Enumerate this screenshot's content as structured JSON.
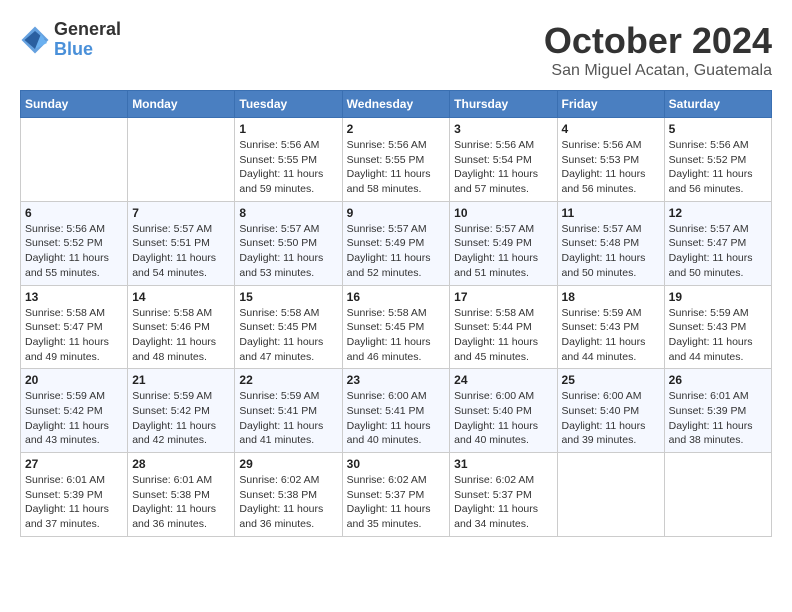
{
  "header": {
    "logo": {
      "general": "General",
      "blue": "Blue"
    },
    "title": "October 2024",
    "location": "San Miguel Acatan, Guatemala"
  },
  "weekdays": [
    "Sunday",
    "Monday",
    "Tuesday",
    "Wednesday",
    "Thursday",
    "Friday",
    "Saturday"
  ],
  "weeks": [
    [
      {
        "day": null
      },
      {
        "day": null
      },
      {
        "day": "1",
        "sunrise": "Sunrise: 5:56 AM",
        "sunset": "Sunset: 5:55 PM",
        "daylight": "Daylight: 11 hours and 59 minutes."
      },
      {
        "day": "2",
        "sunrise": "Sunrise: 5:56 AM",
        "sunset": "Sunset: 5:55 PM",
        "daylight": "Daylight: 11 hours and 58 minutes."
      },
      {
        "day": "3",
        "sunrise": "Sunrise: 5:56 AM",
        "sunset": "Sunset: 5:54 PM",
        "daylight": "Daylight: 11 hours and 57 minutes."
      },
      {
        "day": "4",
        "sunrise": "Sunrise: 5:56 AM",
        "sunset": "Sunset: 5:53 PM",
        "daylight": "Daylight: 11 hours and 56 minutes."
      },
      {
        "day": "5",
        "sunrise": "Sunrise: 5:56 AM",
        "sunset": "Sunset: 5:52 PM",
        "daylight": "Daylight: 11 hours and 56 minutes."
      }
    ],
    [
      {
        "day": "6",
        "sunrise": "Sunrise: 5:56 AM",
        "sunset": "Sunset: 5:52 PM",
        "daylight": "Daylight: 11 hours and 55 minutes."
      },
      {
        "day": "7",
        "sunrise": "Sunrise: 5:57 AM",
        "sunset": "Sunset: 5:51 PM",
        "daylight": "Daylight: 11 hours and 54 minutes."
      },
      {
        "day": "8",
        "sunrise": "Sunrise: 5:57 AM",
        "sunset": "Sunset: 5:50 PM",
        "daylight": "Daylight: 11 hours and 53 minutes."
      },
      {
        "day": "9",
        "sunrise": "Sunrise: 5:57 AM",
        "sunset": "Sunset: 5:49 PM",
        "daylight": "Daylight: 11 hours and 52 minutes."
      },
      {
        "day": "10",
        "sunrise": "Sunrise: 5:57 AM",
        "sunset": "Sunset: 5:49 PM",
        "daylight": "Daylight: 11 hours and 51 minutes."
      },
      {
        "day": "11",
        "sunrise": "Sunrise: 5:57 AM",
        "sunset": "Sunset: 5:48 PM",
        "daylight": "Daylight: 11 hours and 50 minutes."
      },
      {
        "day": "12",
        "sunrise": "Sunrise: 5:57 AM",
        "sunset": "Sunset: 5:47 PM",
        "daylight": "Daylight: 11 hours and 50 minutes."
      }
    ],
    [
      {
        "day": "13",
        "sunrise": "Sunrise: 5:58 AM",
        "sunset": "Sunset: 5:47 PM",
        "daylight": "Daylight: 11 hours and 49 minutes."
      },
      {
        "day": "14",
        "sunrise": "Sunrise: 5:58 AM",
        "sunset": "Sunset: 5:46 PM",
        "daylight": "Daylight: 11 hours and 48 minutes."
      },
      {
        "day": "15",
        "sunrise": "Sunrise: 5:58 AM",
        "sunset": "Sunset: 5:45 PM",
        "daylight": "Daylight: 11 hours and 47 minutes."
      },
      {
        "day": "16",
        "sunrise": "Sunrise: 5:58 AM",
        "sunset": "Sunset: 5:45 PM",
        "daylight": "Daylight: 11 hours and 46 minutes."
      },
      {
        "day": "17",
        "sunrise": "Sunrise: 5:58 AM",
        "sunset": "Sunset: 5:44 PM",
        "daylight": "Daylight: 11 hours and 45 minutes."
      },
      {
        "day": "18",
        "sunrise": "Sunrise: 5:59 AM",
        "sunset": "Sunset: 5:43 PM",
        "daylight": "Daylight: 11 hours and 44 minutes."
      },
      {
        "day": "19",
        "sunrise": "Sunrise: 5:59 AM",
        "sunset": "Sunset: 5:43 PM",
        "daylight": "Daylight: 11 hours and 44 minutes."
      }
    ],
    [
      {
        "day": "20",
        "sunrise": "Sunrise: 5:59 AM",
        "sunset": "Sunset: 5:42 PM",
        "daylight": "Daylight: 11 hours and 43 minutes."
      },
      {
        "day": "21",
        "sunrise": "Sunrise: 5:59 AM",
        "sunset": "Sunset: 5:42 PM",
        "daylight": "Daylight: 11 hours and 42 minutes."
      },
      {
        "day": "22",
        "sunrise": "Sunrise: 5:59 AM",
        "sunset": "Sunset: 5:41 PM",
        "daylight": "Daylight: 11 hours and 41 minutes."
      },
      {
        "day": "23",
        "sunrise": "Sunrise: 6:00 AM",
        "sunset": "Sunset: 5:41 PM",
        "daylight": "Daylight: 11 hours and 40 minutes."
      },
      {
        "day": "24",
        "sunrise": "Sunrise: 6:00 AM",
        "sunset": "Sunset: 5:40 PM",
        "daylight": "Daylight: 11 hours and 40 minutes."
      },
      {
        "day": "25",
        "sunrise": "Sunrise: 6:00 AM",
        "sunset": "Sunset: 5:40 PM",
        "daylight": "Daylight: 11 hours and 39 minutes."
      },
      {
        "day": "26",
        "sunrise": "Sunrise: 6:01 AM",
        "sunset": "Sunset: 5:39 PM",
        "daylight": "Daylight: 11 hours and 38 minutes."
      }
    ],
    [
      {
        "day": "27",
        "sunrise": "Sunrise: 6:01 AM",
        "sunset": "Sunset: 5:39 PM",
        "daylight": "Daylight: 11 hours and 37 minutes."
      },
      {
        "day": "28",
        "sunrise": "Sunrise: 6:01 AM",
        "sunset": "Sunset: 5:38 PM",
        "daylight": "Daylight: 11 hours and 36 minutes."
      },
      {
        "day": "29",
        "sunrise": "Sunrise: 6:02 AM",
        "sunset": "Sunset: 5:38 PM",
        "daylight": "Daylight: 11 hours and 36 minutes."
      },
      {
        "day": "30",
        "sunrise": "Sunrise: 6:02 AM",
        "sunset": "Sunset: 5:37 PM",
        "daylight": "Daylight: 11 hours and 35 minutes."
      },
      {
        "day": "31",
        "sunrise": "Sunrise: 6:02 AM",
        "sunset": "Sunset: 5:37 PM",
        "daylight": "Daylight: 11 hours and 34 minutes."
      },
      {
        "day": null
      },
      {
        "day": null
      }
    ]
  ]
}
